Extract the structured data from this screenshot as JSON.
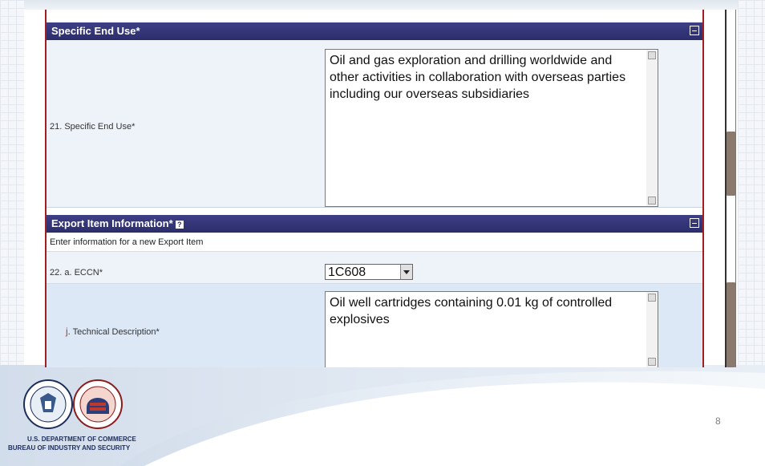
{
  "sections": {
    "end_use": {
      "title": "Specific End Use*",
      "field_label": "21. Specific End Use*",
      "field_value": "Oil and gas exploration and drilling worldwide and other activities in collaboration with overseas parties including our overseas subsidiaries"
    },
    "export_item": {
      "title": "Export Item Information*",
      "help_glyph": "?",
      "instruction": "Enter information for a new Export Item",
      "eccn_label": "22. a. ECCN*",
      "eccn_value": "1C608",
      "tech_label_prefix": "j",
      "tech_label": ". Technical Description*",
      "tech_value": "Oil well cartridges containing 0.01 kg of controlled explosives"
    }
  },
  "footer": {
    "agency_line1": "U.S. DEPARTMENT OF COMMERCE",
    "agency_line2": "BUREAU OF INDUSTRY AND SECURITY",
    "page_number": "8"
  },
  "icons": {
    "collapse": "collapse-icon",
    "help": "help-icon",
    "dropdown": "chevron-down-icon",
    "doc_seal": "commerce-seal-icon",
    "bis_seal": "bis-seal-icon"
  },
  "colors": {
    "header_bg": "#2c2d6c",
    "row_highlight": "#dde8f7",
    "border_accent": "#a02020",
    "agency_text": "#1c2d5a"
  }
}
